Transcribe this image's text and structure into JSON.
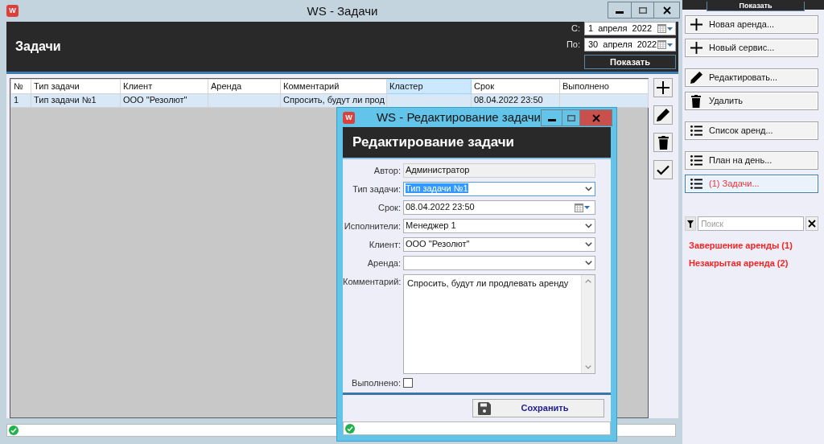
{
  "main_window": {
    "active": false,
    "icon_letter": "W",
    "title": "WS - Задачи",
    "header": "Задачи",
    "period": [
      {
        "label": "С:",
        "value": "1 апреля 2022"
      },
      {
        "label": "По:",
        "value": "30 апреля 2022"
      }
    ],
    "show_button": "Показать",
    "table": {
      "columns": [
        {
          "label": "№",
          "selected": false
        },
        {
          "label": "Тип задачи",
          "selected": false
        },
        {
          "label": "Клиент",
          "selected": false
        },
        {
          "label": "Аренда",
          "selected": false
        },
        {
          "label": "Комментарий",
          "selected": false
        },
        {
          "label": "Кластер",
          "selected": true
        },
        {
          "label": "Срок",
          "selected": false
        },
        {
          "label": "Выполнено",
          "selected": false
        }
      ],
      "rows": [
        {
          "selected": true,
          "cells": [
            "1",
            "Тип задачи №1",
            "ООО \"Резолют\"",
            null,
            "Спросить, будут ли прод",
            null,
            "08.04.2022 23:50",
            null
          ]
        }
      ]
    }
  },
  "side_panel": {
    "top_button": "Показать",
    "groups": [
      {
        "buttons": [
          {
            "kind": "add",
            "label": "Новая аренда...",
            "selected": false,
            "alert": false
          },
          {
            "kind": "add",
            "label": "Новый сервис...",
            "selected": false,
            "alert": false
          }
        ]
      },
      {
        "buttons": [
          {
            "kind": "edit",
            "label": "Редактировать...",
            "selected": false,
            "alert": false
          },
          {
            "kind": "delete",
            "label": "Удалить",
            "selected": false,
            "alert": false
          }
        ]
      },
      {
        "buttons": [
          {
            "kind": "list",
            "label": "Список аренд...",
            "selected": false,
            "alert": false
          }
        ]
      },
      {
        "buttons": [
          {
            "kind": "list",
            "label": "План на день...",
            "selected": false,
            "alert": false
          },
          {
            "kind": "list",
            "label": "(1) Задачи...",
            "selected": true,
            "alert": true
          }
        ]
      }
    ],
    "search": {
      "placeholder": "Поиск"
    },
    "alerts": [
      "Завершение аренды (1)",
      "Незакрытая аренда (2)"
    ]
  },
  "dialog": {
    "active": true,
    "icon_letter": "W",
    "title": "WS - Редактирование задачи",
    "header": "Редактирование задачи",
    "fields": [
      {
        "kind": "readonly",
        "label": "Автор:",
        "value": "Администратор",
        "focused": false
      },
      {
        "kind": "select",
        "label": "Тип задачи:",
        "value": "Тип задачи №1",
        "focused": true
      },
      {
        "kind": "datetime",
        "label": "Срок:",
        "value": "08.04.2022 23:50",
        "focused": false
      },
      {
        "kind": "select",
        "label": "Исполнители:",
        "value": "Менеджер 1",
        "focused": false
      },
      {
        "kind": "select",
        "label": "Клиент:",
        "value": "ООО \"Резолют\"",
        "focused": false
      },
      {
        "kind": "select",
        "label": "Аренда:",
        "focused": false
      },
      {
        "kind": "textarea",
        "label": "Комментарий:",
        "value": "Спросить, будут ли продлевать аренду",
        "focused": false
      },
      {
        "kind": "checkbox",
        "label": "Выполнено:",
        "checked": false,
        "focused": false
      }
    ],
    "save_button": "Сохранить"
  }
}
